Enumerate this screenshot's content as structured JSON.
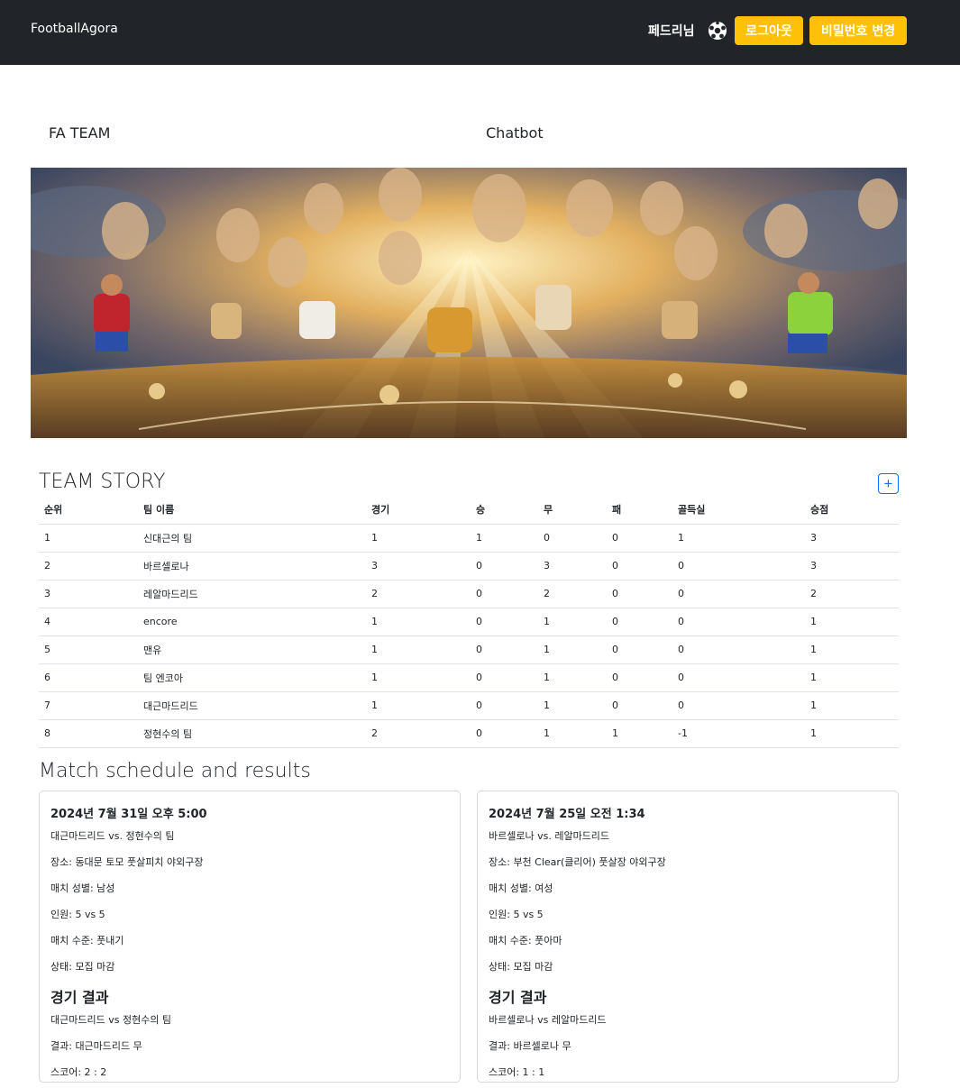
{
  "nav": {
    "brand": "FootballAgora",
    "user": "페드리님",
    "logout_label": "로그아웃",
    "change_pw_label": "비밀번호 변경"
  },
  "subnav": {
    "team": "FA TEAM",
    "chatbot": "Chatbot"
  },
  "team_story": {
    "title": "TEAM STORY",
    "add_label": "+",
    "headers": [
      "순위",
      "팀 이름",
      "경기",
      "승",
      "무",
      "패",
      "골득실",
      "승점"
    ],
    "rows": [
      [
        "1",
        "신대근의 팀",
        "1",
        "1",
        "0",
        "0",
        "1",
        "3"
      ],
      [
        "2",
        "바르셀로나",
        "3",
        "0",
        "3",
        "0",
        "0",
        "3"
      ],
      [
        "3",
        "레알마드리드",
        "2",
        "0",
        "2",
        "0",
        "0",
        "2"
      ],
      [
        "4",
        "encore",
        "1",
        "0",
        "1",
        "0",
        "0",
        "1"
      ],
      [
        "5",
        "맨유",
        "1",
        "0",
        "1",
        "0",
        "0",
        "1"
      ],
      [
        "6",
        "팀 엔코아",
        "1",
        "0",
        "1",
        "0",
        "0",
        "1"
      ],
      [
        "7",
        "대근마드리드",
        "1",
        "0",
        "1",
        "0",
        "0",
        "1"
      ],
      [
        "8",
        "정현수의 팀",
        "2",
        "0",
        "1",
        "1",
        "-1",
        "1"
      ]
    ]
  },
  "matches": {
    "title": "Match schedule and results",
    "cards": [
      {
        "date": "2024년 7월 31일 오후 5:00",
        "teams": "대근마드리드 vs. 정현수의 팀",
        "place": "장소: 동대문 토모 풋살피치 야외구장",
        "gender": "매치 성별: 남성",
        "players": "인원: 5 vs 5",
        "level": "매치 수준: 풋내기",
        "status": "상태: 모집 마감",
        "result_title": "경기 결과",
        "result_teams": "대근마드리드 vs 정현수의 팀",
        "result": "결과: 대근마드리드 무",
        "score": "스코어: 2 : 2"
      },
      {
        "date": "2024년 7월 25일 오전 1:34",
        "teams": "바르셀로나 vs. 레알마드리드",
        "place": "장소: 부천 Clear(클리어) 풋살장 야외구장",
        "gender": "매치 성별: 여성",
        "players": "인원: 5 vs 5",
        "level": "매치 수준: 풋아마",
        "status": "상태: 모집 마감",
        "result_title": "경기 결과",
        "result_teams": "바르셀로나 vs 레알마드리드",
        "result": "결과: 바르셀로나 무",
        "score": "스코어: 1 : 1"
      }
    ]
  },
  "colors": {
    "navbar": "#212529",
    "button": "#ffc107",
    "accent": "#0d6efd"
  }
}
